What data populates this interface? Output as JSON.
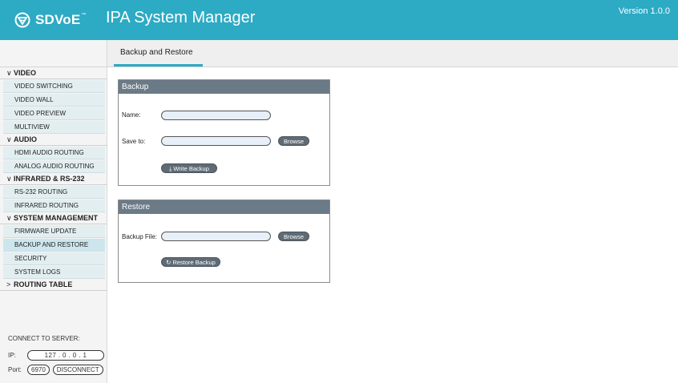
{
  "header": {
    "logo_text": "SDVoE",
    "logo_tm": "™",
    "title": "IPA System Manager",
    "version": "Version 1.0.0",
    "brand_color": "#2daac4"
  },
  "tabs": [
    {
      "label": "Backup and Restore",
      "active": true
    }
  ],
  "sidebar": {
    "groups": [
      {
        "label": "VIDEO",
        "expanded": true,
        "items": [
          "VIDEO SWITCHING",
          "VIDEO WALL",
          "VIDEO PREVIEW",
          "MULTIVIEW"
        ]
      },
      {
        "label": "AUDIO",
        "expanded": true,
        "items": [
          "HDMI AUDIO ROUTING",
          "ANALOG AUDIO ROUTING"
        ]
      },
      {
        "label": "INFRARED & RS-232",
        "expanded": true,
        "items": [
          "RS-232 ROUTING",
          "INFRARED ROUTING"
        ]
      },
      {
        "label": "SYSTEM MANAGEMENT",
        "expanded": true,
        "items": [
          "FIRMWARE UPDATE",
          "BACKUP AND RESTORE",
          "SECURITY",
          "SYSTEM LOGS"
        ],
        "active_item": "BACKUP AND RESTORE"
      },
      {
        "label": "ROUTING TABLE",
        "expanded": false,
        "items": []
      }
    ],
    "chevron_expanded": "∨",
    "chevron_collapsed": ">"
  },
  "connection": {
    "title": "CONNECT TO SERVER:",
    "ip_label": "IP:",
    "ip_value": "127 .  0  .  0  .  1",
    "port_label": "Port:",
    "port_value": "6970",
    "disconnect_label": "DISCONNECT"
  },
  "backup": {
    "title": "Backup",
    "name_label": "Name:",
    "name_value": "",
    "save_label": "Save to:",
    "save_value": "",
    "browse_label": "Browse",
    "write_label": "Write Backup",
    "write_icon": "download-icon"
  },
  "restore": {
    "title": "Restore",
    "file_label": "Backup File:",
    "file_value": "",
    "browse_label": "Browse",
    "restore_label": "Restore Backup",
    "restore_icon": "refresh-icon"
  }
}
